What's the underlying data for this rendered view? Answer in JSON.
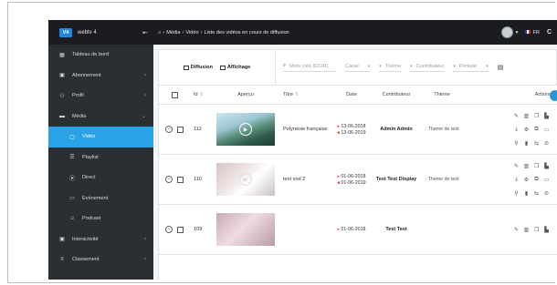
{
  "app": {
    "logo": "V4",
    "name": "webtv 4"
  },
  "topbar": {
    "breadcrumb": [
      "Média",
      "Vidéo",
      "Liste des vidéos en cours de diffusion"
    ],
    "language": "FR"
  },
  "sidebar": {
    "items": [
      {
        "label": "Tableau de bord",
        "icon": "dashboard-icon"
      },
      {
        "label": "Abonnement",
        "icon": "subscription-icon"
      },
      {
        "label": "Profil",
        "icon": "users-icon"
      },
      {
        "label": "Média",
        "icon": "media-icon"
      },
      {
        "label": "Vidéo",
        "icon": "video-icon"
      },
      {
        "label": "Playlist",
        "icon": "playlist-icon"
      },
      {
        "label": "Direct",
        "icon": "live-icon"
      },
      {
        "label": "Evénement",
        "icon": "calendar-icon"
      },
      {
        "label": "Podcast",
        "icon": "podcast-icon"
      },
      {
        "label": "Interactivité",
        "icon": "interactivity-icon"
      },
      {
        "label": "Classement",
        "icon": "ranking-icon"
      }
    ]
  },
  "toolbar": {
    "diffusion_label": "Diffusion",
    "affichage_label": "Affichage",
    "search_placeholder": "Mots clés ID/URL",
    "canal_label": "Canal",
    "theme_label": "Thème",
    "contributeur_label": "Contributeur",
    "periode_label": "Période"
  },
  "table": {
    "headers": {
      "id": "Id",
      "apercu": "Aperçu",
      "titre": "Titre",
      "date": "Date",
      "contributeur": "Contributeur",
      "theme": "Thème",
      "actions": "Actions"
    },
    "rows": [
      {
        "id": "112",
        "title": "Polynésie française",
        "date_start": "13-06-2018",
        "date_end": "13-06-2019",
        "contributor": "Admin Admin",
        "theme": "Theme de test"
      },
      {
        "id": "110",
        "title": "test vod 2",
        "date_start": "01-06-2018",
        "date_end": "01-06-2019",
        "contributor": "Test Test Display",
        "theme": "Theme de test"
      },
      {
        "id": "109",
        "title": "",
        "date_start": "01-06-2018",
        "date_end": "",
        "contributor": "Test Test",
        "theme": ""
      }
    ]
  }
}
